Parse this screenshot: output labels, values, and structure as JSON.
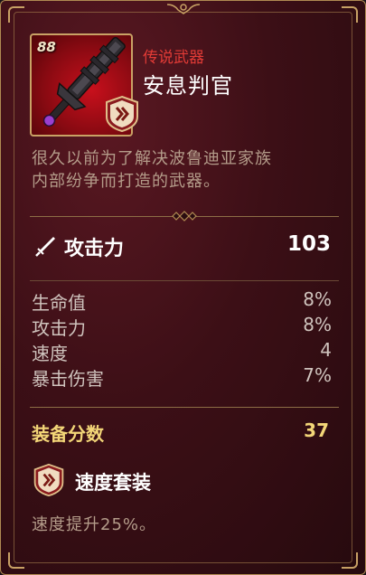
{
  "item": {
    "level": "88",
    "rarity": "传说武器",
    "name": "安息判官",
    "description_line1": "很久以前为了解决波鲁迪亚家族",
    "description_line2": "内部纷争而打造的武器。",
    "icon": "sword-icon",
    "set_badge_icon": "speed-set-icon"
  },
  "main_stat": {
    "icon": "attack-sword-icon",
    "label": "攻击力",
    "value": "103"
  },
  "sub_stats": [
    {
      "label": "生命值",
      "value": "8%"
    },
    {
      "label": "攻击力",
      "value": "8%"
    },
    {
      "label": "速度",
      "value": "4"
    },
    {
      "label": "暴击伤害",
      "value": "7%"
    }
  ],
  "score": {
    "label": "装备分数",
    "value": "37"
  },
  "set": {
    "icon": "speed-set-icon",
    "name": "速度套装",
    "description": "速度提升25%。"
  },
  "colors": {
    "rarity": "#e23b36",
    "score": "#f3d678",
    "frame": "#c9a265",
    "background": "#3c0f16"
  }
}
